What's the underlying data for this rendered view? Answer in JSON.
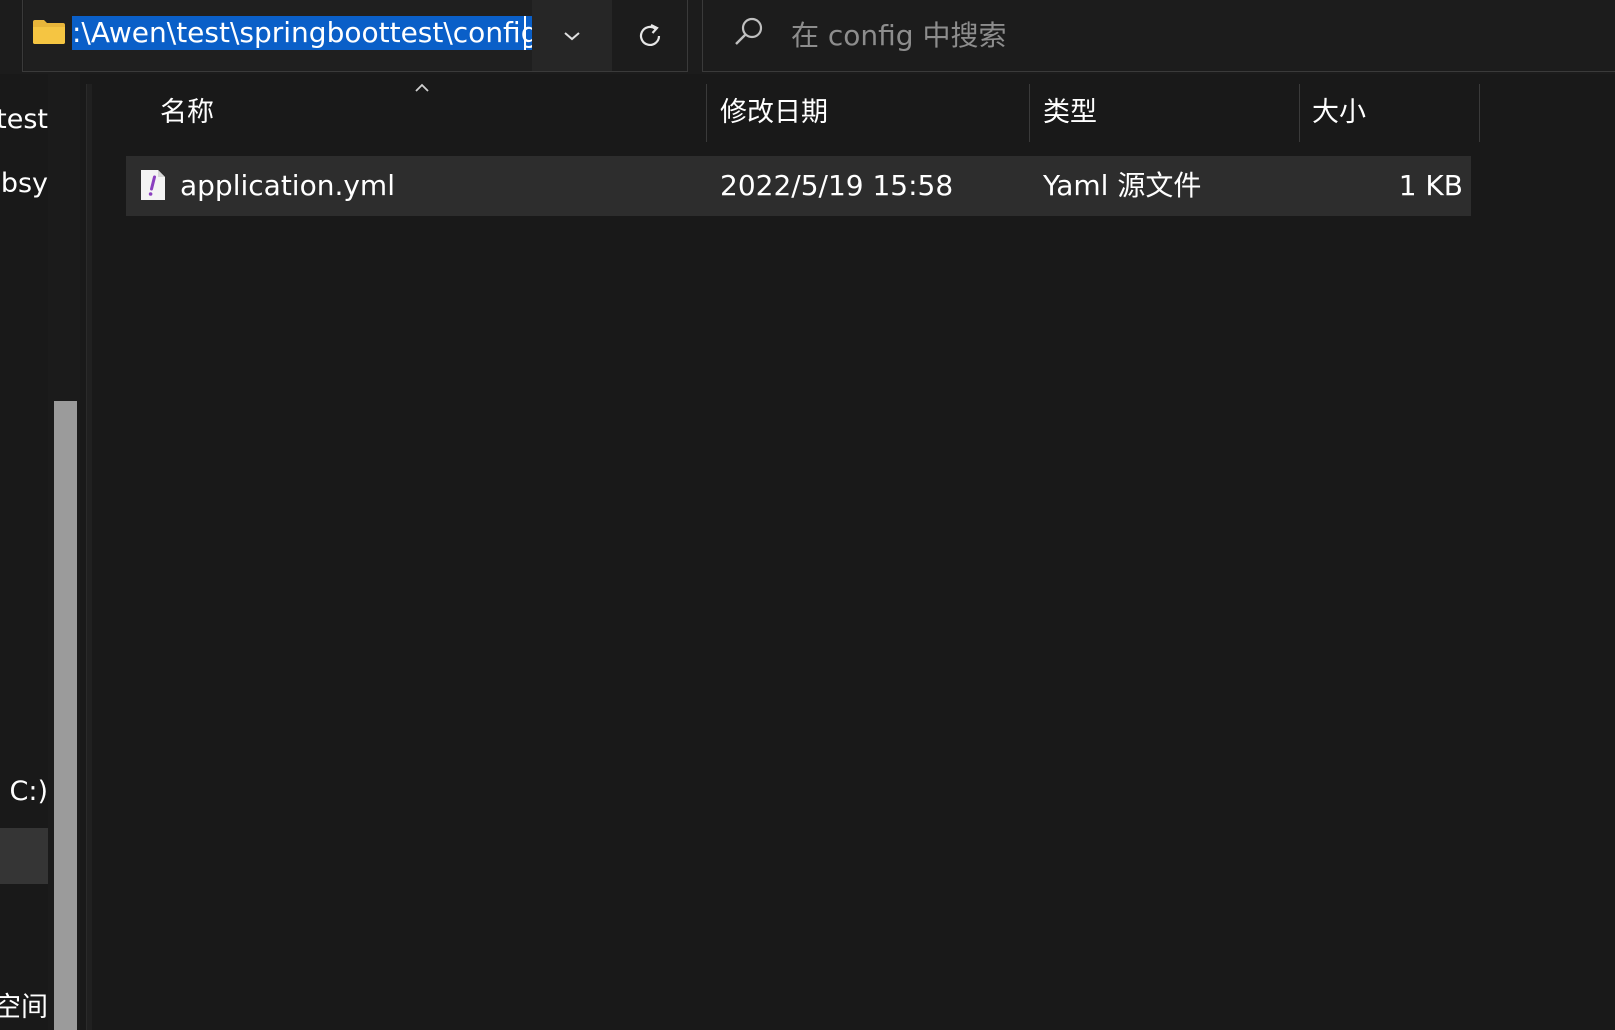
{
  "address_bar": {
    "path": ":\\Awen\\test\\springboottest\\config"
  },
  "search": {
    "placeholder": "在 config 中搜索"
  },
  "nav_pane": {
    "items": [
      {
        "label": "test"
      },
      {
        "label": "ubsy"
      },
      {
        "label": "C:)"
      },
      {
        "label": ""
      },
      {
        "label": "空间"
      }
    ]
  },
  "list": {
    "columns": [
      {
        "label": "名称"
      },
      {
        "label": "修改日期"
      },
      {
        "label": "类型"
      },
      {
        "label": "大小"
      }
    ],
    "rows": [
      {
        "name": "application.yml",
        "modified": "2022/5/19 15:58",
        "type": "Yaml 源文件",
        "size": "1 KB"
      }
    ]
  },
  "colors": {
    "background": "#191919",
    "selection_highlight": "#0a5fc8",
    "row_hover": "#2d2d2d",
    "yaml_icon_accent": "#8a3fbf",
    "folder_yellow": "#f5c542"
  }
}
